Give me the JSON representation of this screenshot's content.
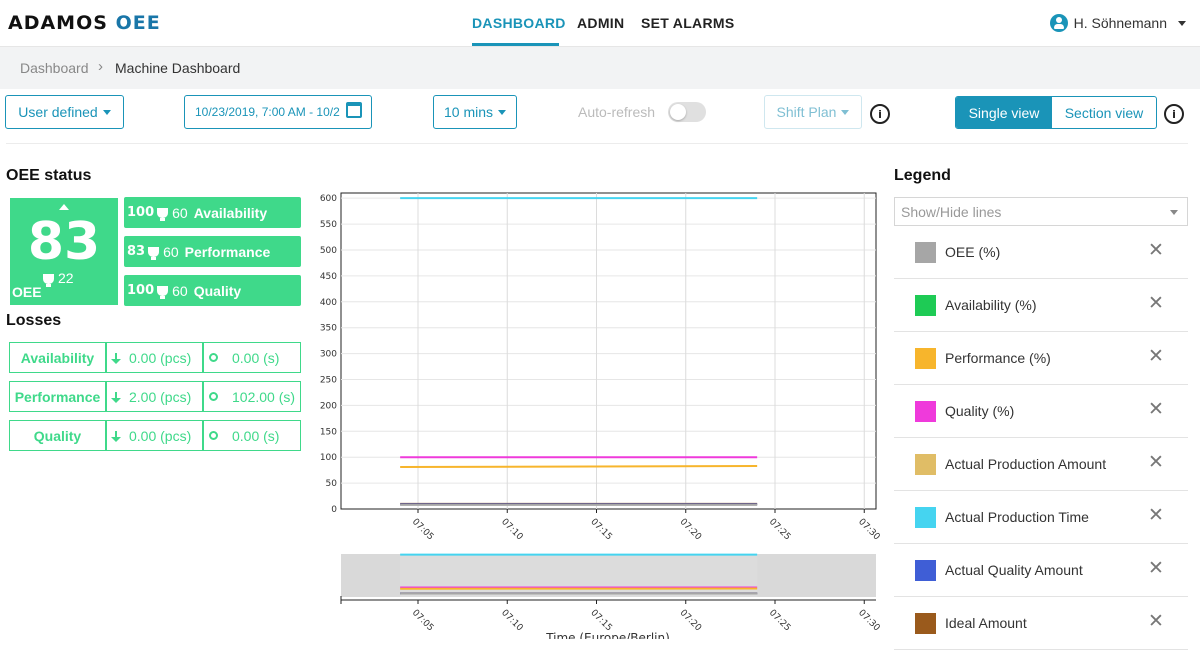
{
  "header": {
    "logo_main": "ADAMOS",
    "logo_sub": "OEE",
    "nav": [
      "DASHBOARD",
      "ADMIN",
      "SET ALARMS"
    ],
    "user": "H. Söhnemann"
  },
  "breadcrumb": {
    "root": "Dashboard",
    "current": "Machine Dashboard"
  },
  "toolbar": {
    "range_mode": "User defined",
    "date_range": "10/23/2019, 7:00 AM - 10/2",
    "interval": "10 mins",
    "auto_refresh": "Auto-refresh",
    "shift_plan": "Shift Plan",
    "info_glyph": "i",
    "single_view": "Single view",
    "section_view": "Section view"
  },
  "oee_status": {
    "title": "OEE status",
    "value": "83",
    "target": "22",
    "label": "OEE",
    "kpis": [
      {
        "value": "100",
        "target": "60",
        "name": "Availability"
      },
      {
        "value": "83",
        "target": "60",
        "name": "Performance"
      },
      {
        "value": "100",
        "target": "60",
        "name": "Quality"
      }
    ]
  },
  "losses": {
    "title": "Losses",
    "rows": [
      {
        "name": "Availability",
        "amount": "0.00 (pcs)",
        "time": "0.00 (s)"
      },
      {
        "name": "Performance",
        "amount": "2.00 (pcs)",
        "time": "102.00 (s)"
      },
      {
        "name": "Quality",
        "amount": "0.00 (pcs)",
        "time": "0.00 (s)"
      }
    ]
  },
  "legend": {
    "title": "Legend",
    "placeholder": "Show/Hide lines",
    "close_glyph": "✕",
    "items": [
      {
        "label": "OEE (%)",
        "color": "#a6a6a6"
      },
      {
        "label": "Availability (%)",
        "color": "#1ecb55"
      },
      {
        "label": "Performance (%)",
        "color": "#f7b52c"
      },
      {
        "label": "Quality (%)",
        "color": "#ef3adb"
      },
      {
        "label": "Actual Production Amount",
        "color": "#e0bd66"
      },
      {
        "label": "Actual Production Time",
        "color": "#45d4f0"
      },
      {
        "label": "Actual Quality Amount",
        "color": "#3f5ed6"
      },
      {
        "label": "Ideal Amount",
        "color": "#9a5a1c"
      }
    ]
  },
  "chart_data": {
    "type": "line",
    "title": "",
    "xlabel": "Time (Europe/Berlin)",
    "ylabel": "",
    "x_ticks": [
      "07:05",
      "07:10",
      "07:15",
      "07:20",
      "07:25",
      "07:30"
    ],
    "y_ticks": [
      0,
      50,
      100,
      150,
      200,
      250,
      300,
      350,
      400,
      450,
      500,
      550,
      600
    ],
    "ylim": [
      0,
      610
    ],
    "grid": true,
    "x": [
      "07:04",
      "07:24"
    ],
    "series": [
      {
        "name": "Actual Production Time",
        "color": "#45d4f0",
        "values": [
          600,
          600
        ]
      },
      {
        "name": "Quality (%)",
        "color": "#ef3adb",
        "values": [
          100,
          100
        ]
      },
      {
        "name": "Performance (%)",
        "color": "#f7b52c",
        "values": [
          81,
          83
        ]
      },
      {
        "name": "Ideal Amount",
        "color": "#9a5a1c",
        "values": [
          10,
          10
        ]
      },
      {
        "name": "Actual Quality Amount",
        "color": "#3f5ed6",
        "values": [
          9,
          9
        ]
      },
      {
        "name": "OEE (%)",
        "color": "#a6a6a6",
        "values": [
          8,
          8
        ]
      }
    ]
  }
}
